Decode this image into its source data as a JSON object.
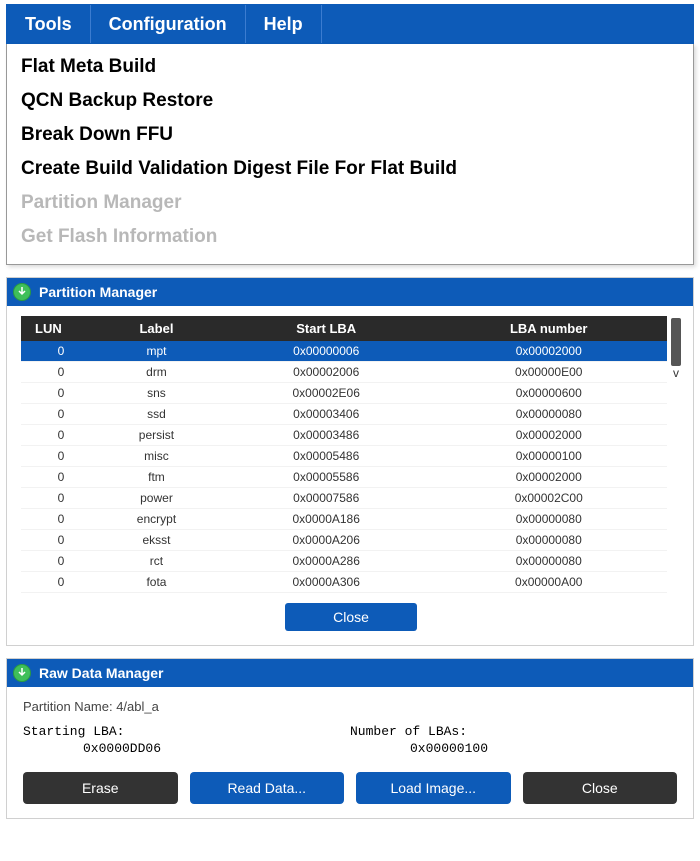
{
  "menubar": {
    "tools": "Tools",
    "configuration": "Configuration",
    "help": "Help"
  },
  "dropdown": {
    "items": [
      {
        "label": "Flat Meta Build",
        "enabled": true
      },
      {
        "label": "QCN Backup Restore",
        "enabled": true
      },
      {
        "label": "Break Down FFU",
        "enabled": true
      },
      {
        "label": "Create Build Validation Digest File For Flat Build",
        "enabled": true
      },
      {
        "label": "Partition Manager",
        "enabled": false
      },
      {
        "label": "Get Flash Information",
        "enabled": false
      }
    ]
  },
  "partition_panel": {
    "title": "Partition Manager",
    "columns": {
      "lun": "LUN",
      "label": "Label",
      "start": "Start LBA",
      "lbanum": "LBA number"
    },
    "rows": [
      {
        "lun": "0",
        "label": "mpt",
        "start": "0x00000006",
        "lbanum": "0x00002000",
        "selected": true
      },
      {
        "lun": "0",
        "label": "drm",
        "start": "0x00002006",
        "lbanum": "0x00000E00",
        "selected": false
      },
      {
        "lun": "0",
        "label": "sns",
        "start": "0x00002E06",
        "lbanum": "0x00000600",
        "selected": false
      },
      {
        "lun": "0",
        "label": "ssd",
        "start": "0x00003406",
        "lbanum": "0x00000080",
        "selected": false
      },
      {
        "lun": "0",
        "label": "persist",
        "start": "0x00003486",
        "lbanum": "0x00002000",
        "selected": false
      },
      {
        "lun": "0",
        "label": "misc",
        "start": "0x00005486",
        "lbanum": "0x00000100",
        "selected": false
      },
      {
        "lun": "0",
        "label": "ftm",
        "start": "0x00005586",
        "lbanum": "0x00002000",
        "selected": false
      },
      {
        "lun": "0",
        "label": "power",
        "start": "0x00007586",
        "lbanum": "0x00002C00",
        "selected": false
      },
      {
        "lun": "0",
        "label": "encrypt",
        "start": "0x0000A186",
        "lbanum": "0x00000080",
        "selected": false
      },
      {
        "lun": "0",
        "label": "eksst",
        "start": "0x0000A206",
        "lbanum": "0x00000080",
        "selected": false
      },
      {
        "lun": "0",
        "label": "rct",
        "start": "0x0000A286",
        "lbanum": "0x00000080",
        "selected": false
      },
      {
        "lun": "0",
        "label": "fota",
        "start": "0x0000A306",
        "lbanum": "0x00000A00",
        "selected": false
      }
    ],
    "close_label": "Close"
  },
  "raw_panel": {
    "title": "Raw Data Manager",
    "partition_name_label": "Partition Name: 4/abl_a",
    "starting_lba_label": "Starting LBA:",
    "number_lbas_label": "Number of LBAs:",
    "starting_lba_value": "0x0000DD06",
    "number_lbas_value": "0x00000100",
    "buttons": {
      "erase": "Erase",
      "read": "Read Data...",
      "load": "Load Image...",
      "close": "Close"
    }
  }
}
